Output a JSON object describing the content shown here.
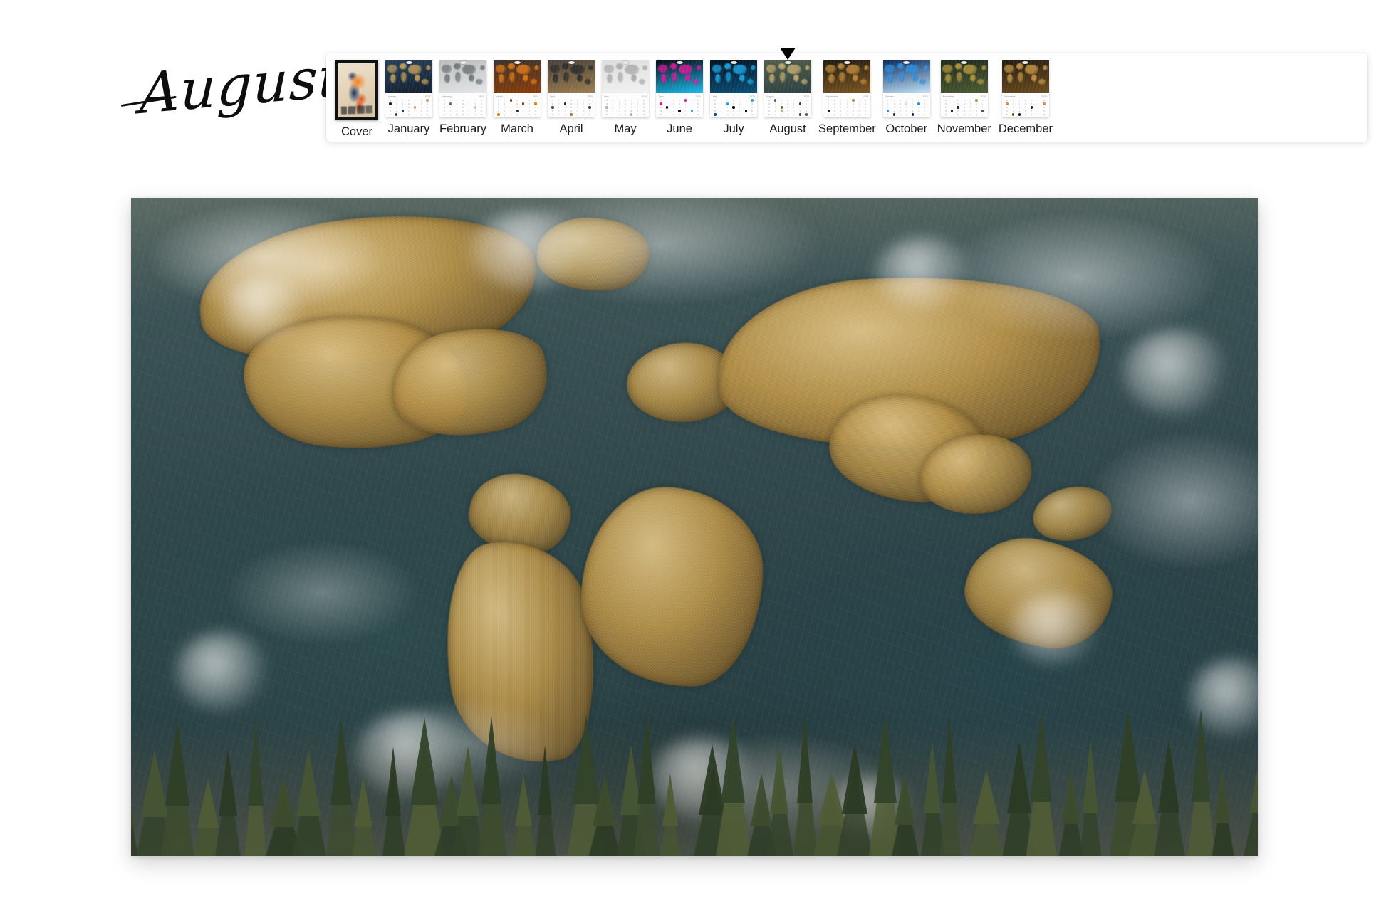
{
  "page": {
    "title": "August",
    "background_color": "#ffffff"
  },
  "hero": {
    "name": "august-calendar-page-preview",
    "alt": "Textured satellite-style world map with gold landmasses, deep teal oceans and a pine forest foreground",
    "palette": {
      "ocean": "#2d4a4c",
      "land": "#b5944f",
      "highland": "#d9c08a",
      "cloud": "#ffffff",
      "forest": "#33432a"
    }
  },
  "thumbnail_strip": {
    "name": "calendar-page-thumbnails",
    "selected": "August",
    "selected_index": 8,
    "marker": "down-triangle",
    "items": [
      {
        "label": "Cover",
        "type": "cover",
        "year": "",
        "palette": [
          "#e9dcc4",
          "#f4811f",
          "#17305e"
        ]
      },
      {
        "label": "January",
        "type": "month",
        "year": "2024",
        "palette": [
          "#2c4661",
          "#c9a martian"
        ],
        "colors": [
          "#24415c",
          "#c7a05a",
          "#14202e"
        ]
      },
      {
        "label": "February",
        "type": "month",
        "year": "2024",
        "colors": [
          "#b9bcbd",
          "#6c7073",
          "#e3e5e6"
        ]
      },
      {
        "label": "March",
        "type": "month",
        "year": "2024",
        "colors": [
          "#3a332e",
          "#e07a14",
          "#8a3c08"
        ]
      },
      {
        "label": "April",
        "type": "month",
        "year": "2024",
        "colors": [
          "#4a4239",
          "#272a2c",
          "#9a7b4e"
        ]
      },
      {
        "label": "May",
        "type": "month",
        "year": "2024",
        "colors": [
          "#dcdcdc",
          "#a8a8a8",
          "#f2f2f2"
        ]
      },
      {
        "label": "June",
        "type": "month",
        "year": "2024",
        "colors": [
          "#0a0a14",
          "#e0179b",
          "#18b9e8"
        ]
      },
      {
        "label": "July",
        "type": "month",
        "year": "2024",
        "colors": [
          "#03121f",
          "#1aa8e6",
          "#0a4f78"
        ]
      },
      {
        "label": "August",
        "type": "month",
        "year": "2024",
        "colors": [
          "#4e5f4a",
          "#c6ab72",
          "#2e4042"
        ]
      },
      {
        "label": "September",
        "type": "month",
        "year": "2024",
        "colors": [
          "#201a12",
          "#c08a3a",
          "#7a5520"
        ]
      },
      {
        "label": "October",
        "type": "month",
        "year": "2024",
        "colors": [
          "#0a2c5e",
          "#2f8fe0",
          "#bfe0f5"
        ]
      },
      {
        "label": "November",
        "type": "month",
        "year": "2024",
        "colors": [
          "#1f2a1c",
          "#b9993f",
          "#4a5a33"
        ]
      },
      {
        "label": "December",
        "type": "month",
        "year": "2024",
        "colors": [
          "#241c12",
          "#c79644",
          "#6b4b1e"
        ]
      }
    ]
  }
}
